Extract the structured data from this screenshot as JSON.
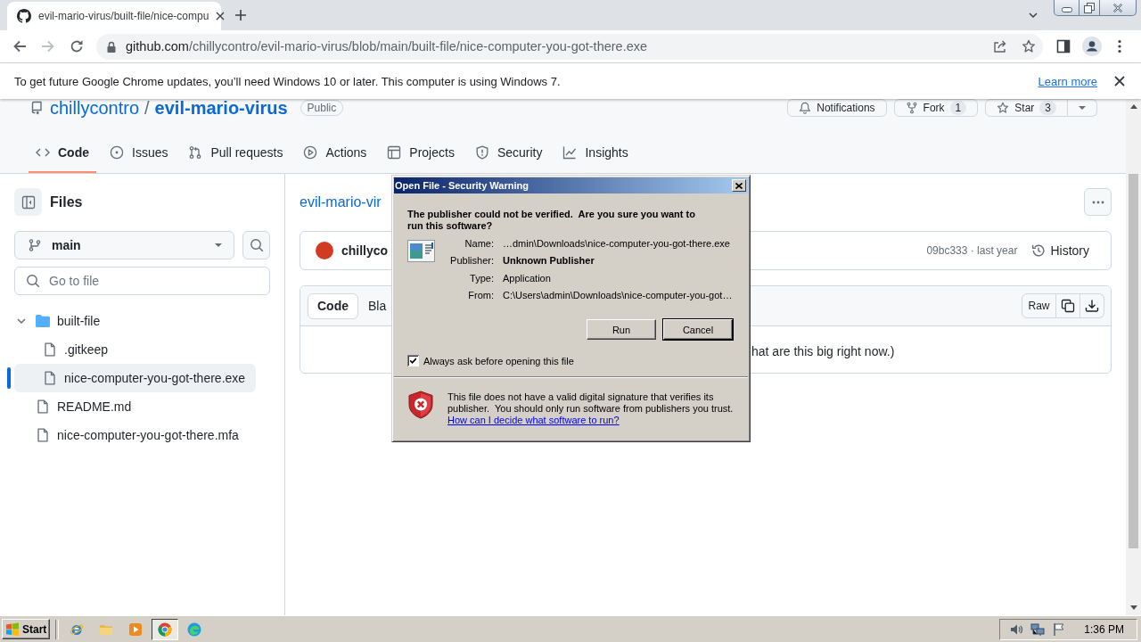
{
  "browser": {
    "tab": {
      "title": "evil-mario-virus/built-file/nice-compu",
      "selected": true
    },
    "back": {
      "disabled": false
    },
    "forward": {
      "disabled": true
    },
    "address": {
      "host": "github.com",
      "path": "/chillycontro/evil-mario-virus/blob/main/built-file/nice-computer-you-got-there.exe"
    },
    "infobar": {
      "message": "To get future Google Chrome updates, you’ll need Windows 10 or later. This computer is using Windows 7.",
      "link": "Learn more"
    }
  },
  "repo": {
    "owner": "chillycontro",
    "separator": "/",
    "name": "evil-mario-virus",
    "visibility": "Public",
    "notifications": {
      "label": "Notifications"
    },
    "fork": {
      "label": "Fork",
      "count": "1"
    },
    "star": {
      "label": "Star",
      "count": "3"
    }
  },
  "nav_tabs": [
    {
      "kind": "code",
      "label": "Code",
      "selected": true
    },
    {
      "kind": "issues",
      "label": "Issues",
      "selected": false
    },
    {
      "kind": "pull_requests",
      "label": "Pull requests",
      "selected": false
    },
    {
      "kind": "actions",
      "label": "Actions",
      "selected": false
    },
    {
      "kind": "projects",
      "label": "Projects",
      "selected": false
    },
    {
      "kind": "security",
      "label": "Security",
      "selected": false
    },
    {
      "kind": "insights",
      "label": "Insights",
      "selected": false
    }
  ],
  "sidebar": {
    "title": "Files",
    "branch": "main",
    "search": {
      "placeholder": "Go to file"
    },
    "tree": [
      {
        "kind": "folder",
        "name": "built-file",
        "expanded": true,
        "selected": false,
        "children": [
          {
            "kind": "file",
            "name": ".gitkeep",
            "selected": false
          },
          {
            "kind": "file",
            "name": "nice-computer-you-got-there.exe",
            "selected": true
          }
        ]
      },
      {
        "kind": "file",
        "name": "README.md",
        "selected": false
      },
      {
        "kind": "file",
        "name": "nice-computer-you-got-there.mfa",
        "selected": false
      }
    ]
  },
  "file_view": {
    "breadcrumb": "evil-mario-vir",
    "commit": {
      "author": "chillyco",
      "meta": "09bc333 · last year",
      "history": "History"
    },
    "view_tabs": [
      {
        "label": "Code",
        "selected": true
      },
      {
        "label": "Bla",
        "selected": false
      }
    ],
    "raw": "Raw",
    "message": "hat are this big right now.)"
  },
  "dialog": {
    "title": "Open File - Security Warning",
    "question": "The publisher could not be verified.  Are you sure you want to run this software?",
    "fields": [
      {
        "label": "Name:",
        "value": "…dmin\\Downloads\\nice-computer-you-got-there.exe",
        "bold": false
      },
      {
        "label": "Publisher:",
        "value": "Unknown Publisher",
        "bold": true
      },
      {
        "label": "Type:",
        "value": "Application",
        "bold": false
      },
      {
        "label": "From:",
        "value": "C:\\Users\\admin\\Downloads\\nice-computer-you-got…",
        "bold": false
      }
    ],
    "buttons": [
      {
        "label": "Run",
        "default": false
      },
      {
        "label": "Cancel",
        "default": true
      }
    ],
    "checkbox": {
      "label": "Always ask before opening this file",
      "checked": true
    },
    "warning": "This file does not have a valid digital signature that verifies its publisher.  You should only run software from publishers you trust.",
    "link": "How can I decide what software to run?"
  },
  "taskbar": {
    "start": "Start",
    "apps": [
      {
        "selected": false
      },
      {
        "selected": false
      },
      {
        "selected": false
      },
      {
        "selected": true
      },
      {
        "selected": false
      }
    ],
    "clock": "1:36 PM"
  }
}
